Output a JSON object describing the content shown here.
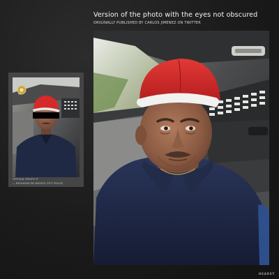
{
  "headline": "Version of the photo with the eyes not obscured",
  "subline": "ORIGINALLY PUBLISHED BY CARLOS JIMENEZ ON TWITTER",
  "small_photo": {
    "badge_text": "SSC",
    "caption_line1": "OFFICIAL PHOTO ©",
    "caption_line2": "— RELEASED BY MEXICO CITY POLICE"
  },
  "credit": "HEARST"
}
